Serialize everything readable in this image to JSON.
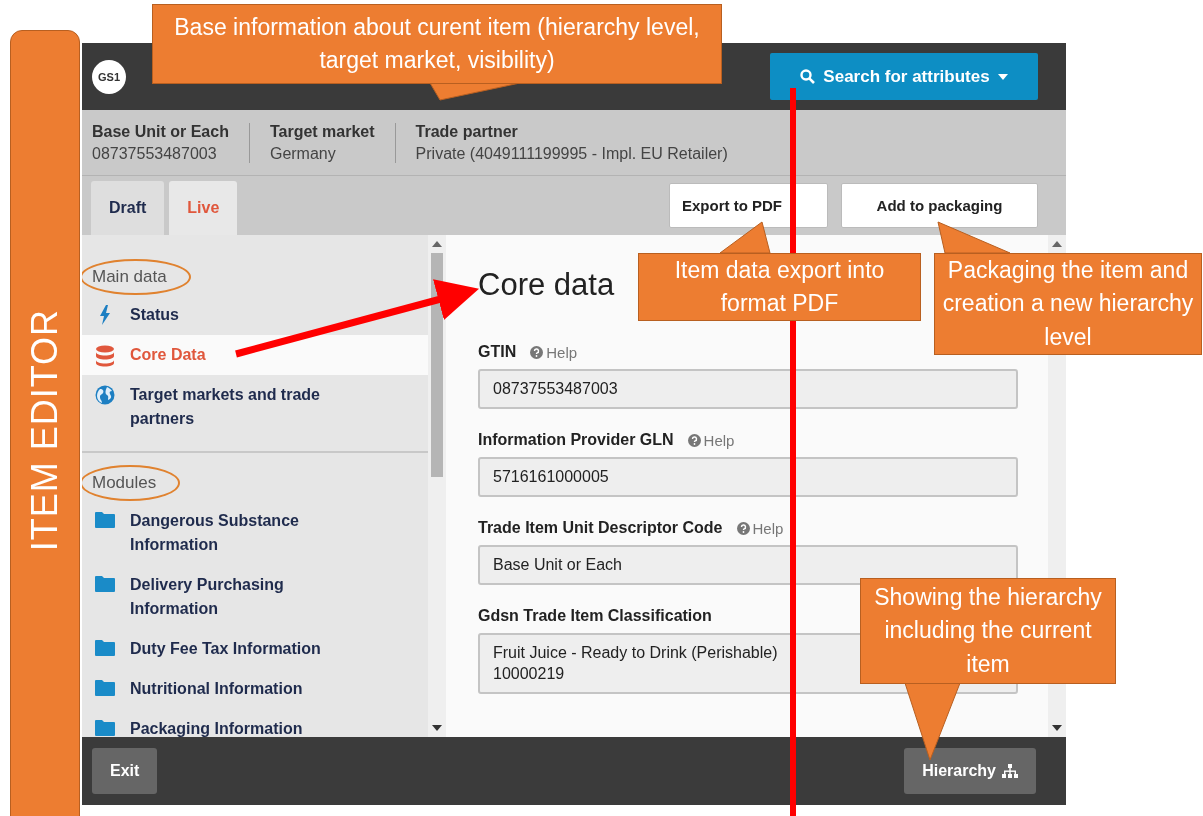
{
  "side_label": "ITEM EDITOR",
  "header": {
    "logo": "GS1",
    "search_button": "Search for attributes"
  },
  "info": [
    {
      "label": "Base Unit or Each",
      "value": "08737553487003"
    },
    {
      "label": "Target market",
      "value": "Germany"
    },
    {
      "label": "Trade partner",
      "value": "Private (4049111199995 - Impl. EU Retailer)"
    }
  ],
  "tabs": [
    {
      "label": "Draft",
      "selected": false
    },
    {
      "label": "Live",
      "selected": true
    }
  ],
  "actions": [
    "Export to PDF",
    "Add to packaging"
  ],
  "sidebar": [
    {
      "title": "Main data",
      "highlighted": true,
      "items": [
        {
          "label": "Status",
          "kind": "bolt",
          "selected": false
        },
        {
          "label": "Core Data",
          "kind": "database",
          "selected": true
        },
        {
          "label": "Target markets and trade partners",
          "kind": "globe",
          "selected": false
        }
      ]
    },
    {
      "title": "Modules",
      "highlighted": true,
      "items": [
        {
          "label": "Dangerous Substance Information",
          "kind": "folder",
          "selected": false
        },
        {
          "label": "Delivery Purchasing Information",
          "kind": "folder",
          "selected": false
        },
        {
          "label": "Duty Fee Tax Information",
          "kind": "folder",
          "selected": false
        },
        {
          "label": "Nutritional Information",
          "kind": "folder",
          "selected": false
        },
        {
          "label": "Packaging Information",
          "kind": "folder",
          "selected": false
        }
      ]
    }
  ],
  "content": {
    "title": "Core data",
    "fields": [
      {
        "label": "GTIN",
        "help": "Help",
        "value": "08737553487003"
      },
      {
        "label": "Information Provider GLN",
        "help": "Help",
        "value": "5716161000005"
      },
      {
        "label": "Trade Item Unit Descriptor Code",
        "help": "Help",
        "value": "Base Unit or Each"
      },
      {
        "label": "Gdsn Trade Item Classification",
        "value": "Fruit Juice - Ready to Drink (Perishable)",
        "value_2": "10000219"
      }
    ]
  },
  "footer": {
    "exit": "Exit",
    "hierarchy": "Hierarchy"
  },
  "callouts": [
    "Base information about curent item (hierarchy level, target market, visibility)",
    "Item data export into format PDF",
    "Packaging the item and  creation a new hierarchy level",
    "Showing the hierarchy including the current item"
  ]
}
